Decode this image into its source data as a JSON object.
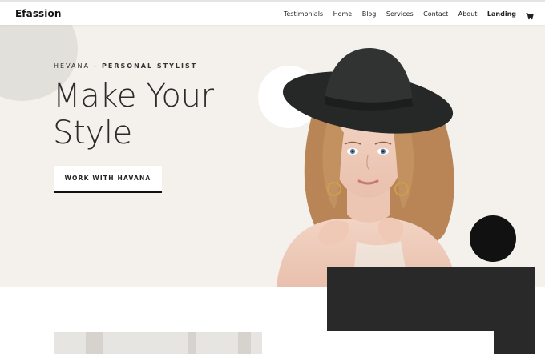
{
  "header": {
    "logo": "Efassion",
    "nav": [
      "Testimonials",
      "Home",
      "Blog",
      "Services",
      "Contact",
      "About",
      "Landing"
    ],
    "cart_icon": "cart-icon"
  },
  "hero": {
    "subtitle_part1": "HEVANA – ",
    "subtitle_part2": "PERSONAL STYLIST",
    "headline_line1": "Make Your",
    "headline_line2": "Style",
    "cta_label": "WORK WITH HAVANA"
  },
  "colors": {
    "hero_background": "#f4f1ec",
    "dark_block": "#292929",
    "accent_black": "#111111",
    "text": "#2b2b2b"
  }
}
